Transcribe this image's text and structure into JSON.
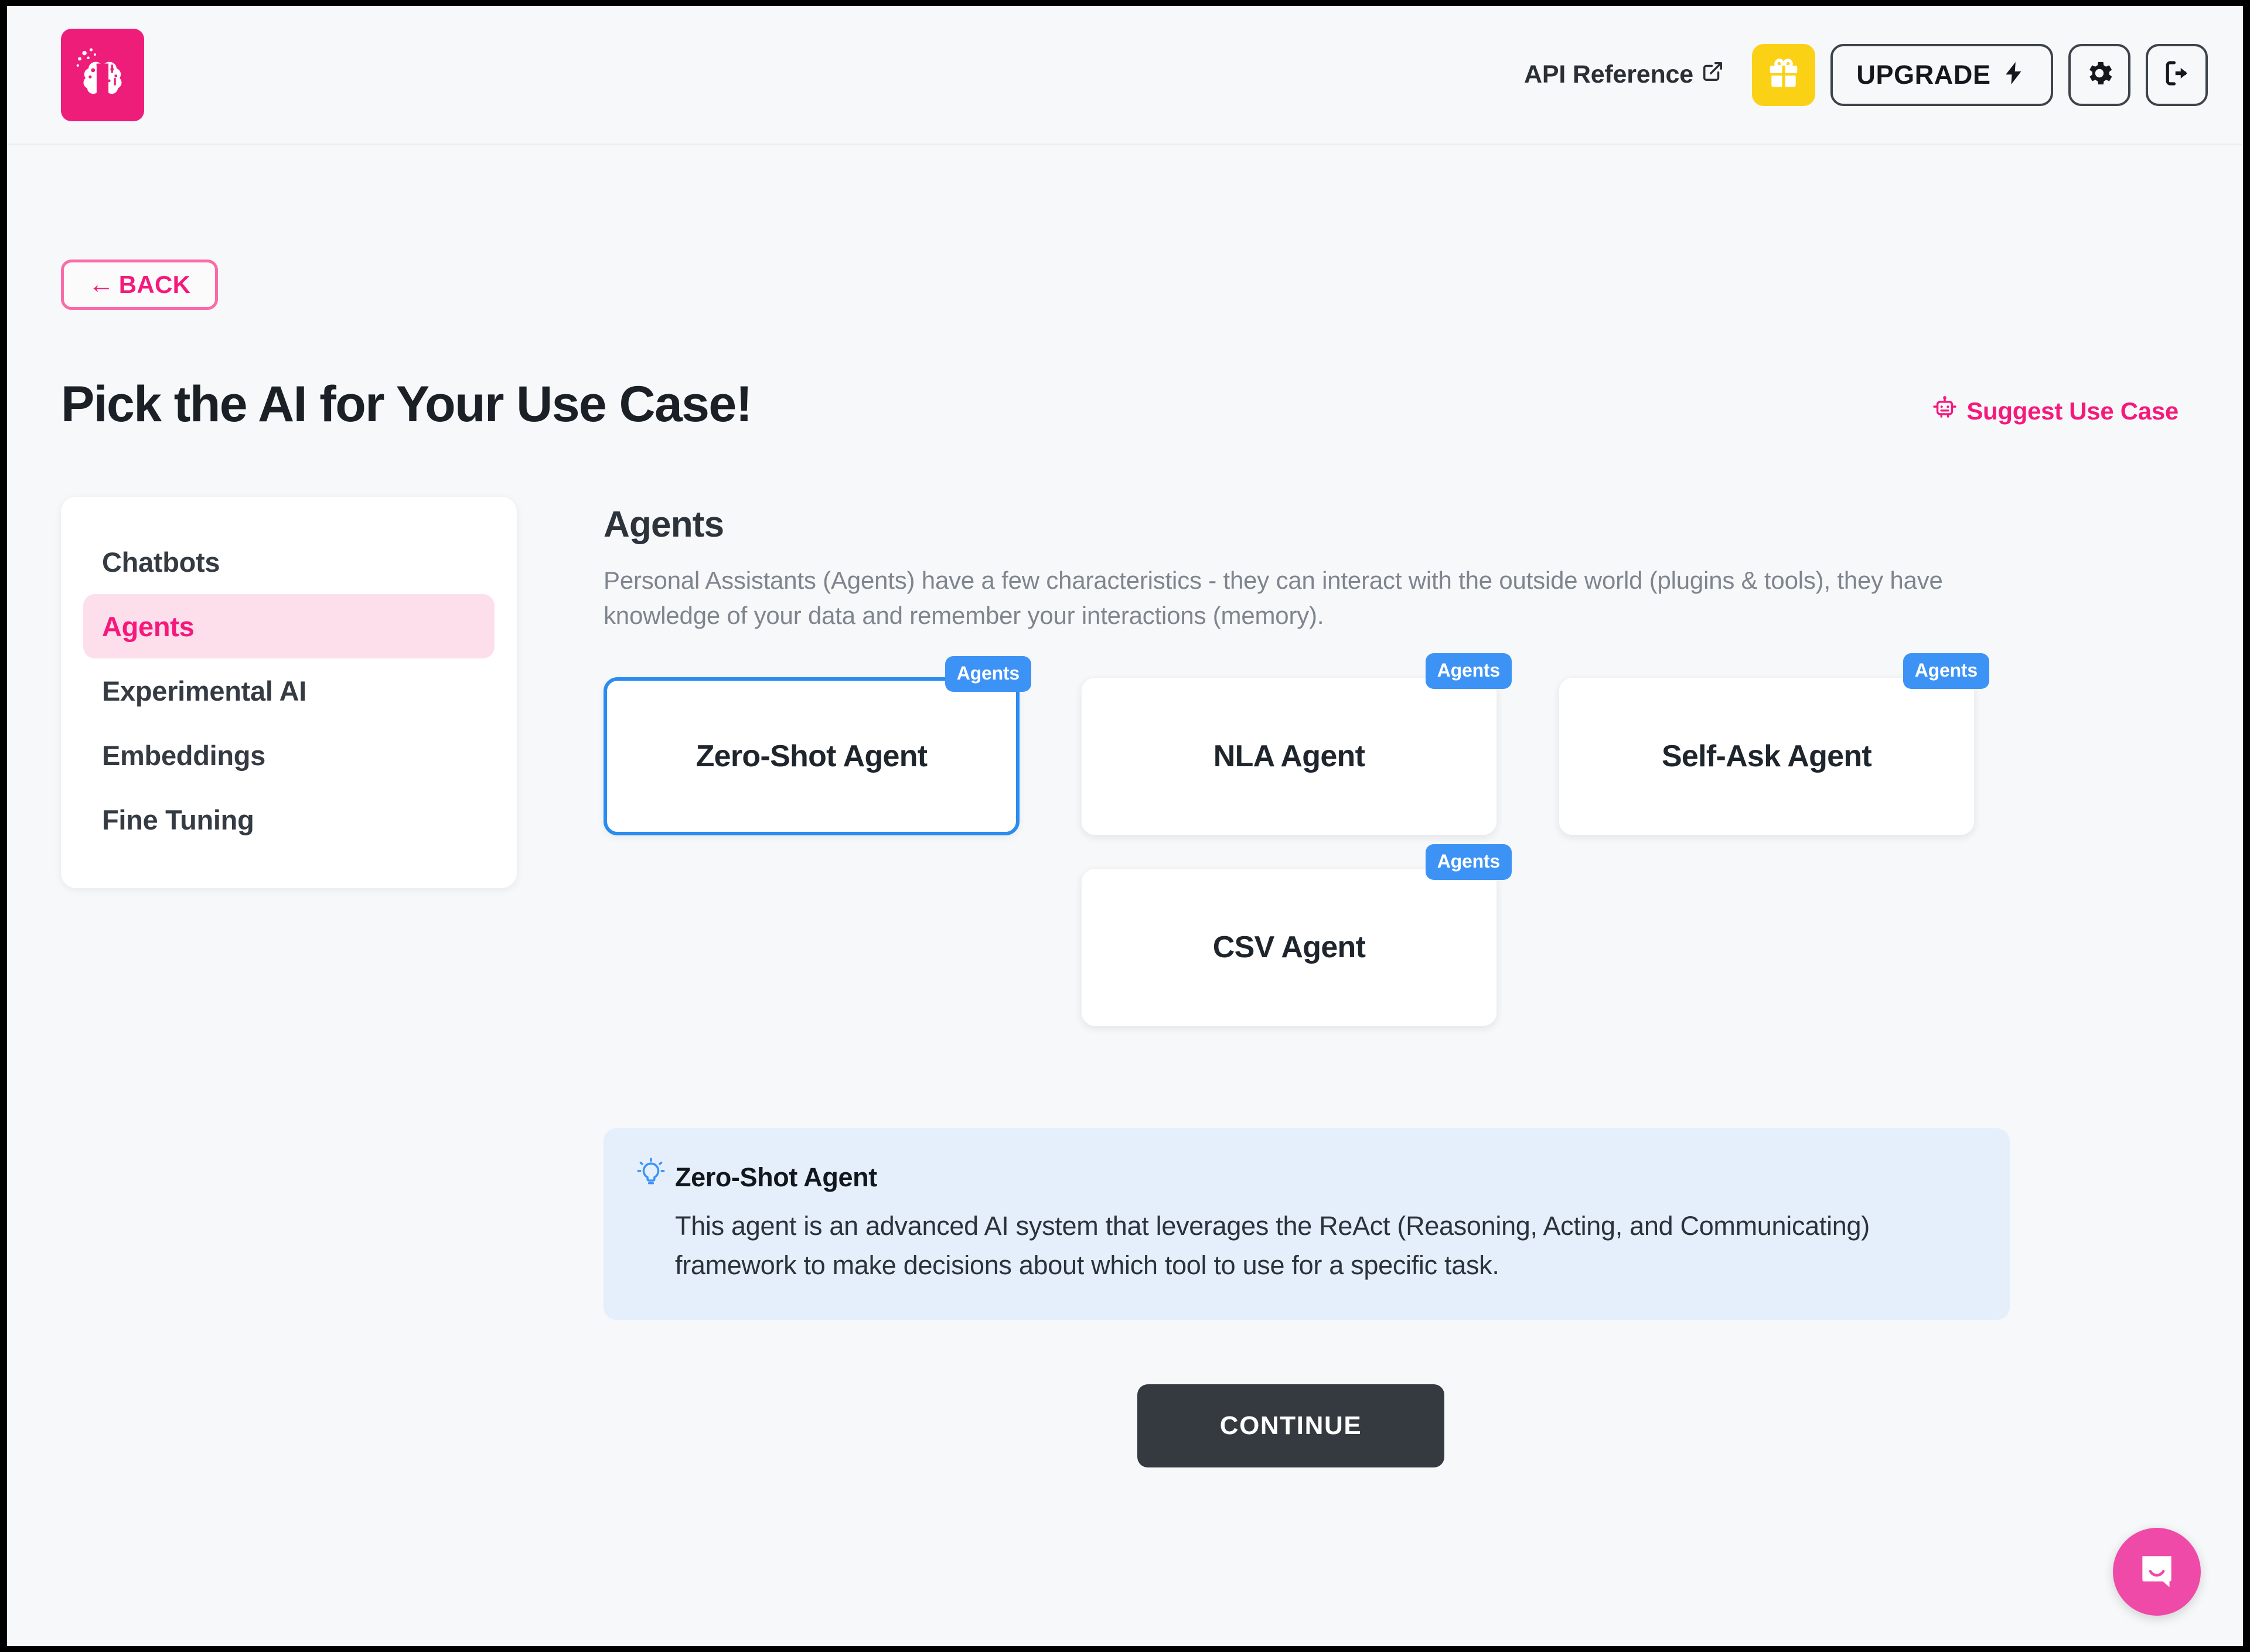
{
  "header": {
    "logo_icon": "brain-logo-icon",
    "api_reference_label": "API Reference",
    "external_link_icon": "external-link-icon",
    "gift_icon": "gift-icon",
    "upgrade_label": "UPGRADE",
    "lightning_icon": "lightning-bolt-icon",
    "settings_icon": "gear-icon",
    "logout_icon": "logout-icon"
  },
  "page": {
    "back_arrow": "←",
    "back_label": "BACK",
    "title": "Pick the AI for Your Use Case!",
    "suggest_label": "Suggest Use Case",
    "suggest_icon": "robot-icon"
  },
  "sidebar": {
    "items": [
      {
        "label": "Chatbots",
        "active": false
      },
      {
        "label": "Agents",
        "active": true
      },
      {
        "label": "Experimental AI",
        "active": false
      },
      {
        "label": "Embeddings",
        "active": false
      },
      {
        "label": "Fine Tuning",
        "active": false
      }
    ]
  },
  "main": {
    "section_title": "Agents",
    "section_desc": "Personal Assistants (Agents) have a few characteristics - they can interact with the outside world (plugins & tools), they have knowledge of your data and remember your interactions (memory).",
    "cards": [
      {
        "name": "Zero-Shot Agent",
        "badge": "Agents",
        "selected": true
      },
      {
        "name": "NLA Agent",
        "badge": "Agents",
        "selected": false
      },
      {
        "name": "Self-Ask Agent",
        "badge": "Agents",
        "selected": false
      },
      {
        "name": "CSV Agent",
        "badge": "Agents",
        "selected": false
      }
    ]
  },
  "info_panel": {
    "icon": "lightbulb-icon",
    "title": "Zero-Shot Agent",
    "body": "This agent is an advanced AI system that leverages the ReAct (Reasoning, Acting, and Communicating) framework to make decisions about which tool to use for a specific task."
  },
  "footer": {
    "continue_label": "CONTINUE"
  },
  "chat_widget": {
    "icon": "chat-bubble-icon"
  },
  "colors": {
    "brand_pink": "#ee1d7a",
    "link_pink": "#f5197c",
    "active_pink_bg": "#fddfeb",
    "badge_blue": "#3d93f5",
    "selected_border_blue": "#2b8cf0",
    "info_panel_bg": "#e4effb",
    "gift_yellow": "#fbd116",
    "continue_dark": "#343a40",
    "page_bg": "#f7f8fa",
    "chat_pink": "#ef4aa8"
  }
}
